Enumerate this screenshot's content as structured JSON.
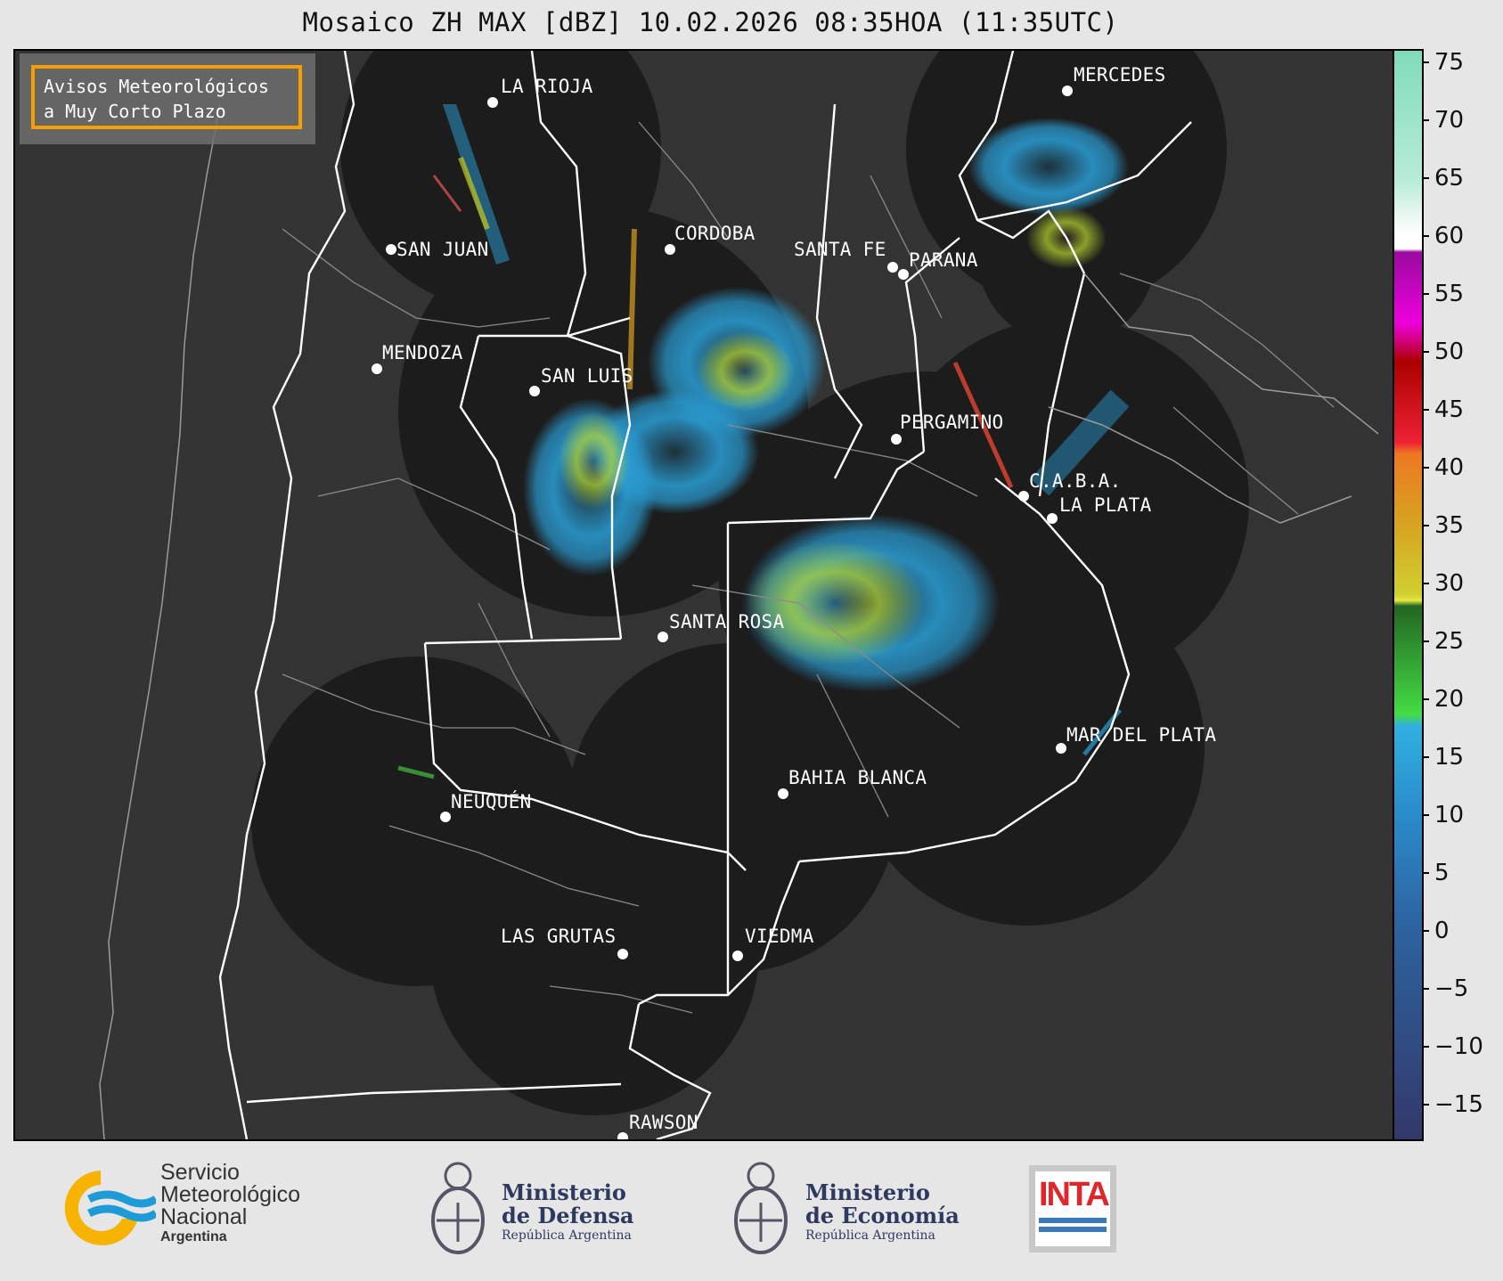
{
  "title": "Mosaico ZH MAX [dBZ] 10.02.2026 08:35HOA (11:35UTC)",
  "avisos": {
    "line1": "Avisos Meteorológicos",
    "line2": "a Muy Corto Plazo"
  },
  "cities": [
    {
      "name": "LA RIOJA"
    },
    {
      "name": "MERCEDES"
    },
    {
      "name": "SAN JUAN"
    },
    {
      "name": "CORDOBA"
    },
    {
      "name": "SANTA FE"
    },
    {
      "name": "PARANA"
    },
    {
      "name": "MENDOZA"
    },
    {
      "name": "SAN LUIS"
    },
    {
      "name": "PERGAMINO"
    },
    {
      "name": "C.A.B.A."
    },
    {
      "name": "LA PLATA"
    },
    {
      "name": "SANTA ROSA"
    },
    {
      "name": "MAR DEL PLATA"
    },
    {
      "name": "BAHIA BLANCA"
    },
    {
      "name": "NEUQUÉN"
    },
    {
      "name": "LAS GRUTAS"
    },
    {
      "name": "VIEDMA"
    },
    {
      "name": "RAWSON"
    }
  ],
  "colorbar": {
    "unit": "dBZ",
    "range": [
      -18,
      76
    ],
    "ticks": [
      "75",
      "70",
      "65",
      "60",
      "55",
      "50",
      "45",
      "40",
      "35",
      "30",
      "25",
      "20",
      "15",
      "10",
      "5",
      "0",
      "−5",
      "−10",
      "−15"
    ],
    "colors": {
      "high": "#7fdcb8",
      "white": "#ffffff",
      "magenta": "#cc00cc",
      "red": "#cc0011",
      "orange": "#e0801c",
      "yellow": "#d8d830",
      "green": "#2ea82e",
      "cyan": "#2aa0d8",
      "blue": "#2c6aa6",
      "navy": "#2c3a70"
    }
  },
  "logos": {
    "smn": {
      "line1": "Servicio",
      "line2": "Meteorológico",
      "line3": "Nacional",
      "line4": "Argentina"
    },
    "defensa": {
      "line1": "Ministerio",
      "line2": "de Defensa",
      "line3": "República Argentina"
    },
    "economia": {
      "line1": "Ministerio",
      "line2": "de Economía",
      "line3": "República Argentina"
    },
    "inta": {
      "text": "INTA"
    }
  }
}
